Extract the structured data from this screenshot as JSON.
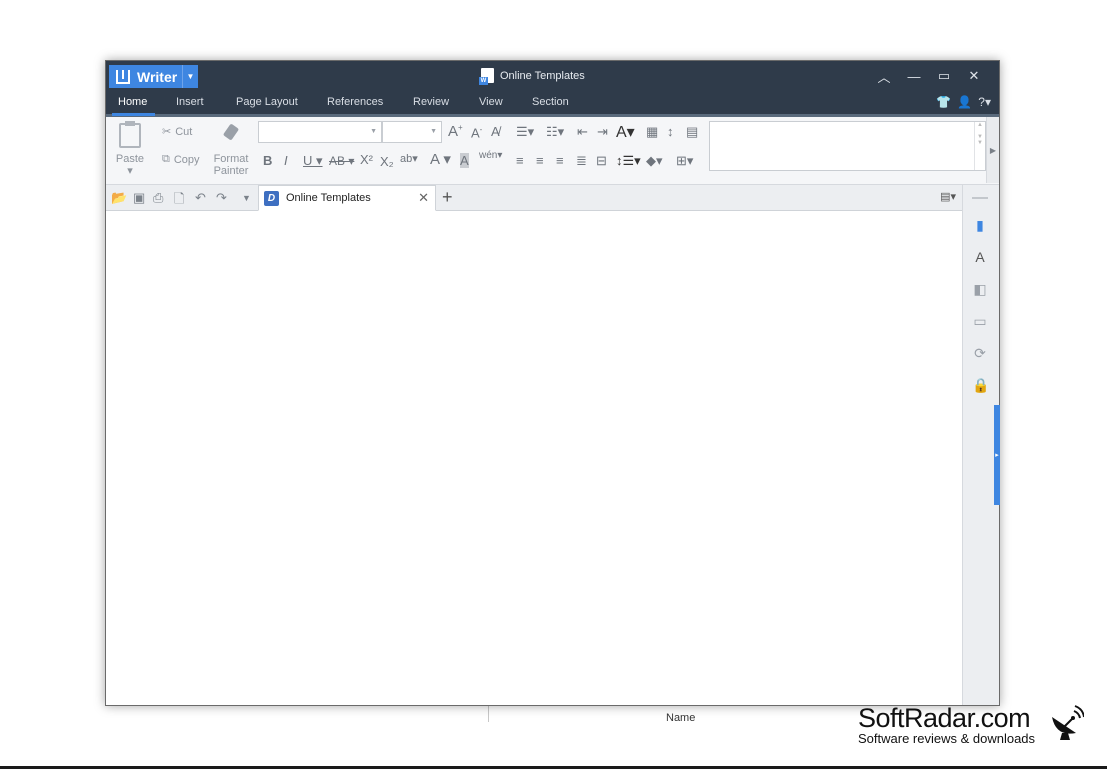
{
  "window": {
    "title": "Online Templates"
  },
  "app": {
    "name": "Writer"
  },
  "menu": {
    "items": [
      "Home",
      "Insert",
      "Page Layout",
      "References",
      "Review",
      "View",
      "Section"
    ]
  },
  "ribbon": {
    "paste_label": "Paste",
    "cut_label": "Cut",
    "copy_label": "Copy",
    "format_painter_line1": "Format",
    "format_painter_line2": "Painter",
    "font_name": "",
    "font_size": ""
  },
  "tabs": {
    "doc_title": "Online Templates"
  },
  "background": {
    "name_label": "Name"
  },
  "watermark": {
    "title": "SoftRadar.com",
    "subtitle": "Software reviews & downloads"
  },
  "colors": {
    "titlebar": "#2f3b4a",
    "accent": "#3e86e1"
  }
}
